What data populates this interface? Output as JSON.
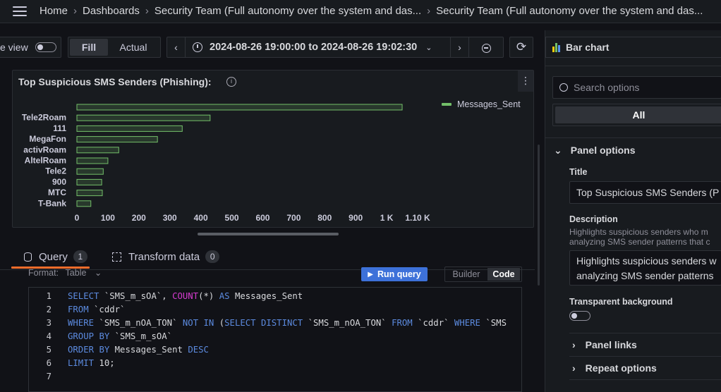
{
  "breadcrumbs": [
    "Home",
    "Dashboards",
    "Security Team (Full autonomy over the system and das...",
    "Security Team (Full autonomy over the system and das..."
  ],
  "toolbar": {
    "table_view_label": "e view",
    "fill_label": "Fill",
    "actual_label": "Actual",
    "time_range": "2024-08-26 19:00:00 to 2024-08-26 19:02:30"
  },
  "panel": {
    "title": "Top Suspicious SMS Senders (Phishing):",
    "menu": "⋮"
  },
  "chart_data": {
    "type": "bar",
    "orientation": "horizontal",
    "categories": [
      "",
      "Tele2Roam",
      "111",
      "MegaFon",
      "activRoam",
      "AltelRoam",
      "Tele2",
      "900",
      "MTC",
      "T-Bank"
    ],
    "series": [
      {
        "name": "Messages_Sent",
        "values": [
          1050,
          430,
          340,
          260,
          135,
          100,
          85,
          80,
          82,
          45
        ]
      }
    ],
    "x_ticks": [
      "0",
      "100",
      "200",
      "300",
      "400",
      "500",
      "600",
      "700",
      "800",
      "900",
      "1 K",
      "1.10 K"
    ],
    "xlim": [
      0,
      1100
    ],
    "legend": "top-right",
    "color": "#73bf69"
  },
  "query_tabs": {
    "query_label": "Query",
    "query_count": "1",
    "transform_label": "Transform data",
    "transform_count": "0"
  },
  "query_bar": {
    "format_label": "Format:",
    "format_value": "Table",
    "run_label": "Run query",
    "builder_label": "Builder",
    "code_label": "Code"
  },
  "code_lines": [
    {
      "n": "1",
      "text": "SELECT `SMS_m_sOA`, COUNT(*) AS Messages_Sent"
    },
    {
      "n": "2",
      "text": "FROM `cddr`"
    },
    {
      "n": "3",
      "text": "WHERE `SMS_m_nOA_TON` NOT IN (SELECT DISTINCT `SMS_m_nOA_TON` FROM `cddr` WHERE `SMS"
    },
    {
      "n": "4",
      "text": "GROUP BY `SMS_m_sOA`"
    },
    {
      "n": "5",
      "text": "ORDER BY Messages_Sent DESC"
    },
    {
      "n": "6",
      "text": "LIMIT 10;"
    },
    {
      "n": "7",
      "text": ""
    }
  ],
  "options": {
    "viz_label": "Bar chart",
    "search_placeholder": "Search options",
    "all_label": "All",
    "panel_options_label": "Panel options",
    "title_label": "Title",
    "title_value": "Top Suspicious SMS Senders (P",
    "description_label": "Description",
    "description_hint_1": "Highlights suspicious senders who m",
    "description_hint_2": "analyzing SMS sender patterns that c",
    "description_value_1": "Highlights suspicious senders w",
    "description_value_2": "analyzing SMS sender patterns",
    "transparent_label": "Transparent background",
    "panel_links_label": "Panel links",
    "repeat_options_label": "Repeat options"
  }
}
